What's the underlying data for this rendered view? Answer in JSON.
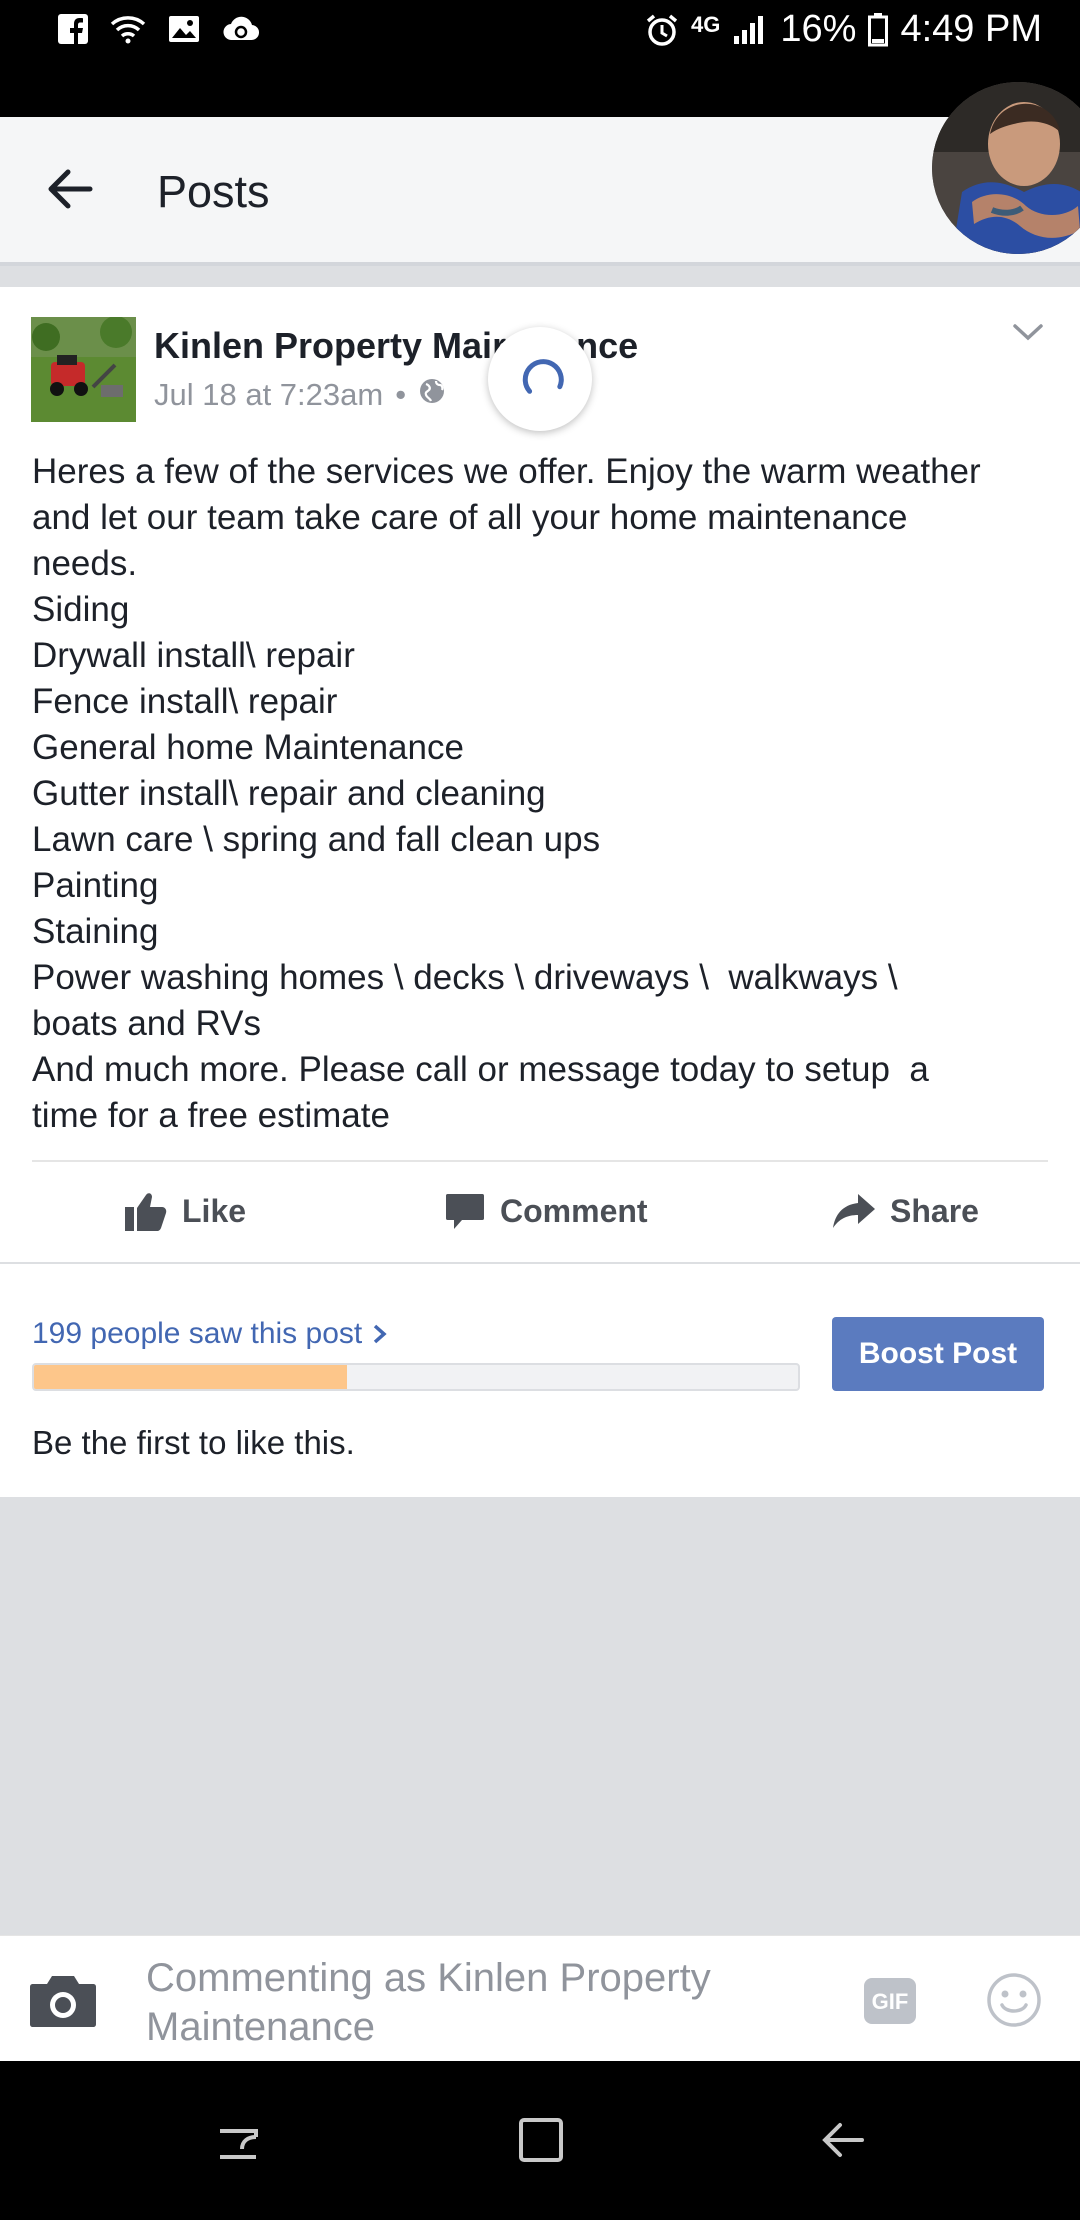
{
  "status_bar": {
    "network": "4G",
    "battery": "16%",
    "time": "4:49 PM",
    "left_icons": [
      "facebook-icon",
      "wifi-icon",
      "image-icon",
      "cloud-icon"
    ],
    "right_icons": [
      "alarm-icon",
      "signal-icon",
      "battery-icon"
    ]
  },
  "header": {
    "title": "Posts"
  },
  "post": {
    "author": "Kinlen Property Maintenance",
    "author_display": "Kinlen Property Mair",
    "author_display_tail": "nce",
    "timestamp": "Jul 18 at 7:23am",
    "separator": "•",
    "privacy_icon": "globe-icon",
    "body": "Heres a few of the services we offer. Enjoy the warm weather\nand let our team take care of all your home maintenance\nneeds.\nSiding\nDrywall install\\ repair\nFence install\\ repair\nGeneral home Maintenance\nGutter install\\ repair and cleaning\nLawn care \\ spring and fall clean ups\nPainting\nStaining\nPower washing homes \\ decks \\ driveways \\  walkways \\\nboats and RVs\nAnd much more. Please call or message today to setup  a\ntime for a free estimate"
  },
  "actions": {
    "like": "Like",
    "comment": "Comment",
    "share": "Share"
  },
  "insights": {
    "reach_text": "199 people saw this post",
    "progress_fraction": 0.41,
    "boost_label": "Boost Post",
    "likes_text": "Be the first to like this."
  },
  "composer": {
    "placeholder": "Commenting as Kinlen Property Maintenance",
    "gif_label": "GIF"
  },
  "colors": {
    "link": "#4267b2",
    "boost_button": "#5b7bbf",
    "progress_fill": "#fdc68a",
    "background": "#dddfe2"
  }
}
